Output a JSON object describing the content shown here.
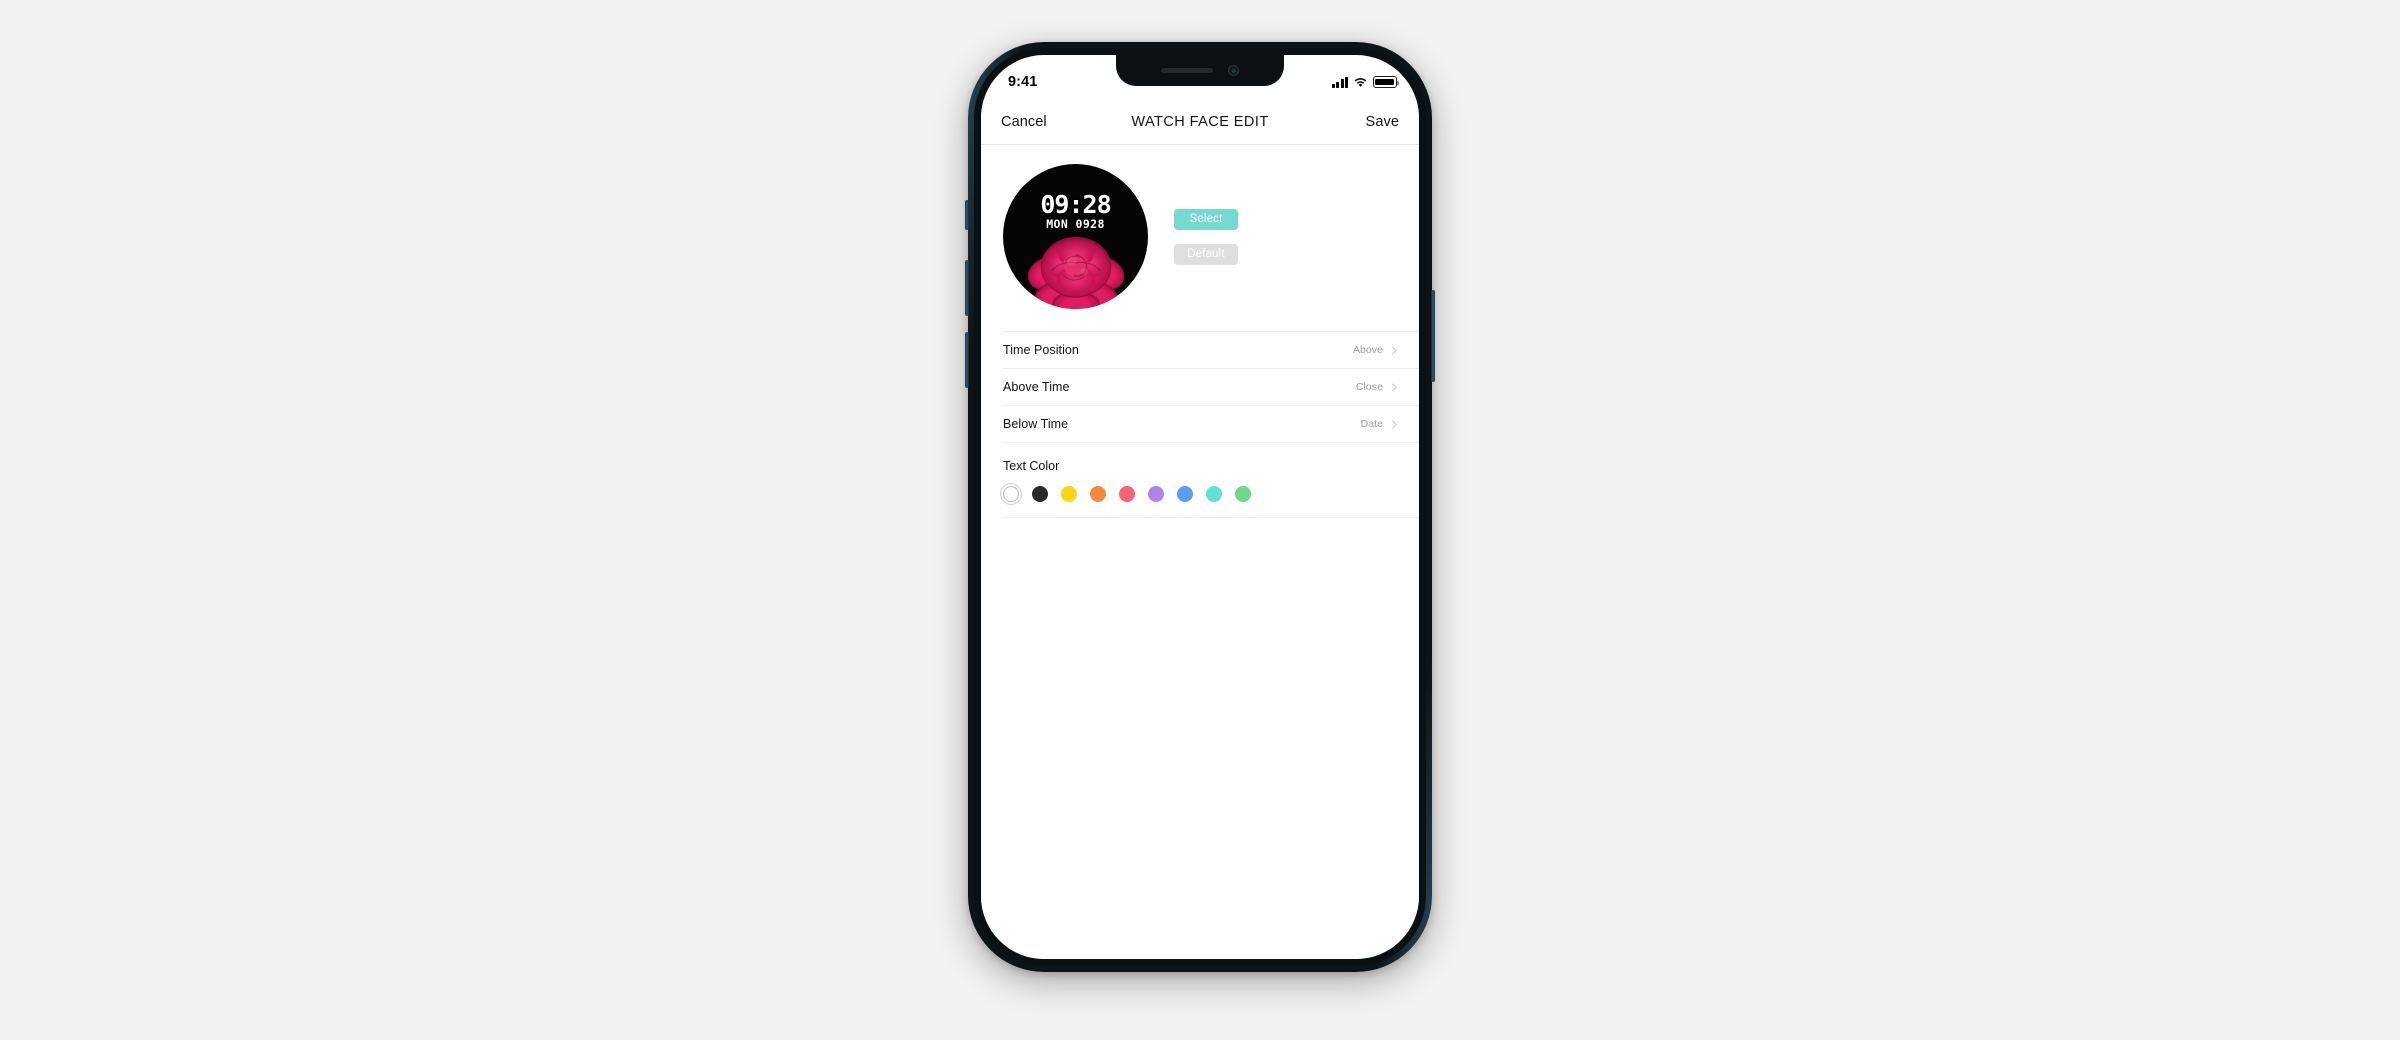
{
  "page": {
    "background_color": "#f2f2f2"
  },
  "device": {
    "frame_color": "#0d1418",
    "accent_edge_color": "#2c4a5e",
    "buttons": [
      {
        "name": "silent-switch"
      },
      {
        "name": "volume-up-button"
      },
      {
        "name": "volume-down-button"
      },
      {
        "name": "power-button"
      }
    ],
    "notch": {
      "speaker_label": "earpiece-speaker",
      "camera_label": "front-camera"
    }
  },
  "status_bar": {
    "time": "9:41",
    "icons": [
      "cellular-signal-icon",
      "wifi-icon",
      "battery-icon"
    ]
  },
  "navbar": {
    "cancel_label": "Cancel",
    "title": "WATCH FACE EDIT",
    "save_label": "Save"
  },
  "preview": {
    "watch_face": {
      "time": "09:28",
      "subtitle": "MON 0928",
      "background_color": "#050505",
      "text_color": "#ffffff",
      "image": "rose-photo"
    },
    "buttons": [
      {
        "label": "Select",
        "color": "#76d9d0",
        "name": "select-button",
        "enabled": true
      },
      {
        "label": "Default",
        "color": "#dedede",
        "name": "default-button",
        "enabled": false
      }
    ]
  },
  "settings_rows": [
    {
      "label": "Time Position",
      "value": "Above",
      "name": "time-position"
    },
    {
      "label": "Above Time",
      "value": "Close",
      "name": "above-time"
    },
    {
      "label": "Below Time",
      "value": "Date",
      "name": "below-time"
    }
  ],
  "text_color_section": {
    "title": "Text Color",
    "selected_index": 0,
    "swatches": [
      {
        "name": "white",
        "color": "#ffffff",
        "selected": true
      },
      {
        "name": "black",
        "color": "#2b2b2b",
        "selected": false
      },
      {
        "name": "yellow",
        "color": "#fcd514",
        "selected": false
      },
      {
        "name": "orange",
        "color": "#f58a3c",
        "selected": false
      },
      {
        "name": "pink",
        "color": "#f86275",
        "selected": false
      },
      {
        "name": "purple",
        "color": "#ab86e8",
        "selected": false
      },
      {
        "name": "blue",
        "color": "#5b9cf8",
        "selected": false
      },
      {
        "name": "teal",
        "color": "#61e0d6",
        "selected": false
      },
      {
        "name": "green",
        "color": "#6fd98a",
        "selected": false
      }
    ]
  }
}
